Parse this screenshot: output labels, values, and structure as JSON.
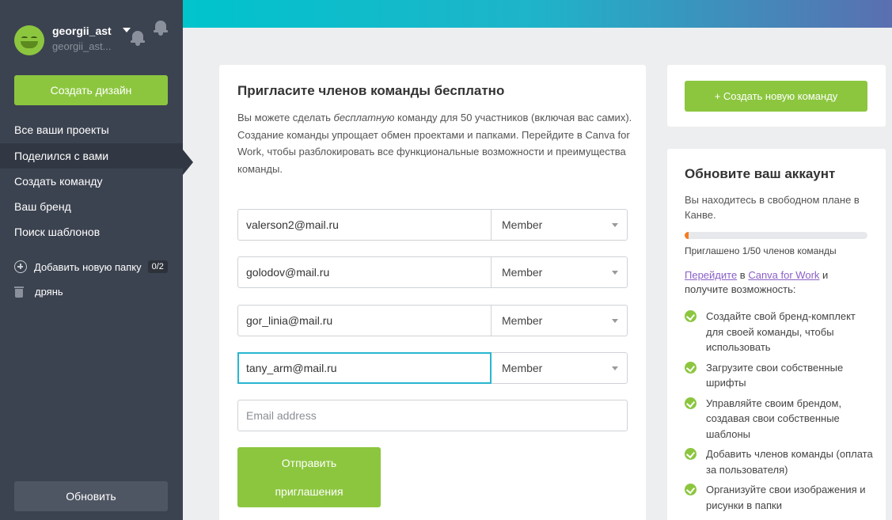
{
  "user": {
    "name": "georgii_ast",
    "handle": "georgii_ast..."
  },
  "sidebar": {
    "create_design": "Создать дизайн",
    "items": [
      {
        "label": "Все ваши проекты"
      },
      {
        "label": "Поделился с вами"
      },
      {
        "label": "Создать команду"
      },
      {
        "label": "Ваш бренд"
      },
      {
        "label": "Поиск шаблонов"
      }
    ],
    "active_item": "Поделился с вами",
    "add_folder": "Добавить новую папку",
    "folder_count": "0/2",
    "trash": "дрянь",
    "upgrade": "Обновить"
  },
  "invite": {
    "title": "Пригласите членов команды бесплатно",
    "desc_part1": "Вы можете сделать ",
    "desc_italic": "бесплатную",
    "desc_part2": " команду для 50 участников (включая вас самих).",
    "desc_line2": "Создание команды упрощает обмен проектами и папками. Перейдите в Canva for Work, чтобы разблокировать все функциональные возможности и преимущества команды.",
    "rows": [
      {
        "email": "valerson2@mail.ru",
        "role": "Member"
      },
      {
        "email": "golodov@mail.ru",
        "role": "Member"
      },
      {
        "email": "gor_linia@mail.ru",
        "role": "Member"
      },
      {
        "email": "tany_arm@mail.ru",
        "role": "Member"
      }
    ],
    "email_placeholder": "Email address",
    "send_line1": "Отправить",
    "send_line2": "приглашения"
  },
  "right": {
    "new_team": "+ Создать новую команду",
    "upgrade_title": "Обновите ваш аккаунт",
    "upgrade_desc": "Вы находитесь в свободном плане в Канве.",
    "progress_fraction": 0.02,
    "progress_label": "Приглашено 1/50 членов команды",
    "go_link": "Перейдите",
    "go_mid": " в ",
    "go_link2": "Canva for Work",
    "go_tail": " и получите возможность:",
    "benefits": [
      "Создайте свой бренд-комплект для своей команды, чтобы использовать",
      "Загрузите свои собственные шрифты",
      "Управляйте своим брендом, создавая свои собственные шаблоны",
      "Добавить членов команды (оплата за пользователя)",
      "Организуйте свои изображения и рисунки в папки"
    ]
  },
  "colors": {
    "accent": "#8cc63f",
    "sidebar": "#3c4350",
    "focus": "#27b6d0",
    "progress": "#f37c21",
    "link": "#8a5fc7"
  }
}
